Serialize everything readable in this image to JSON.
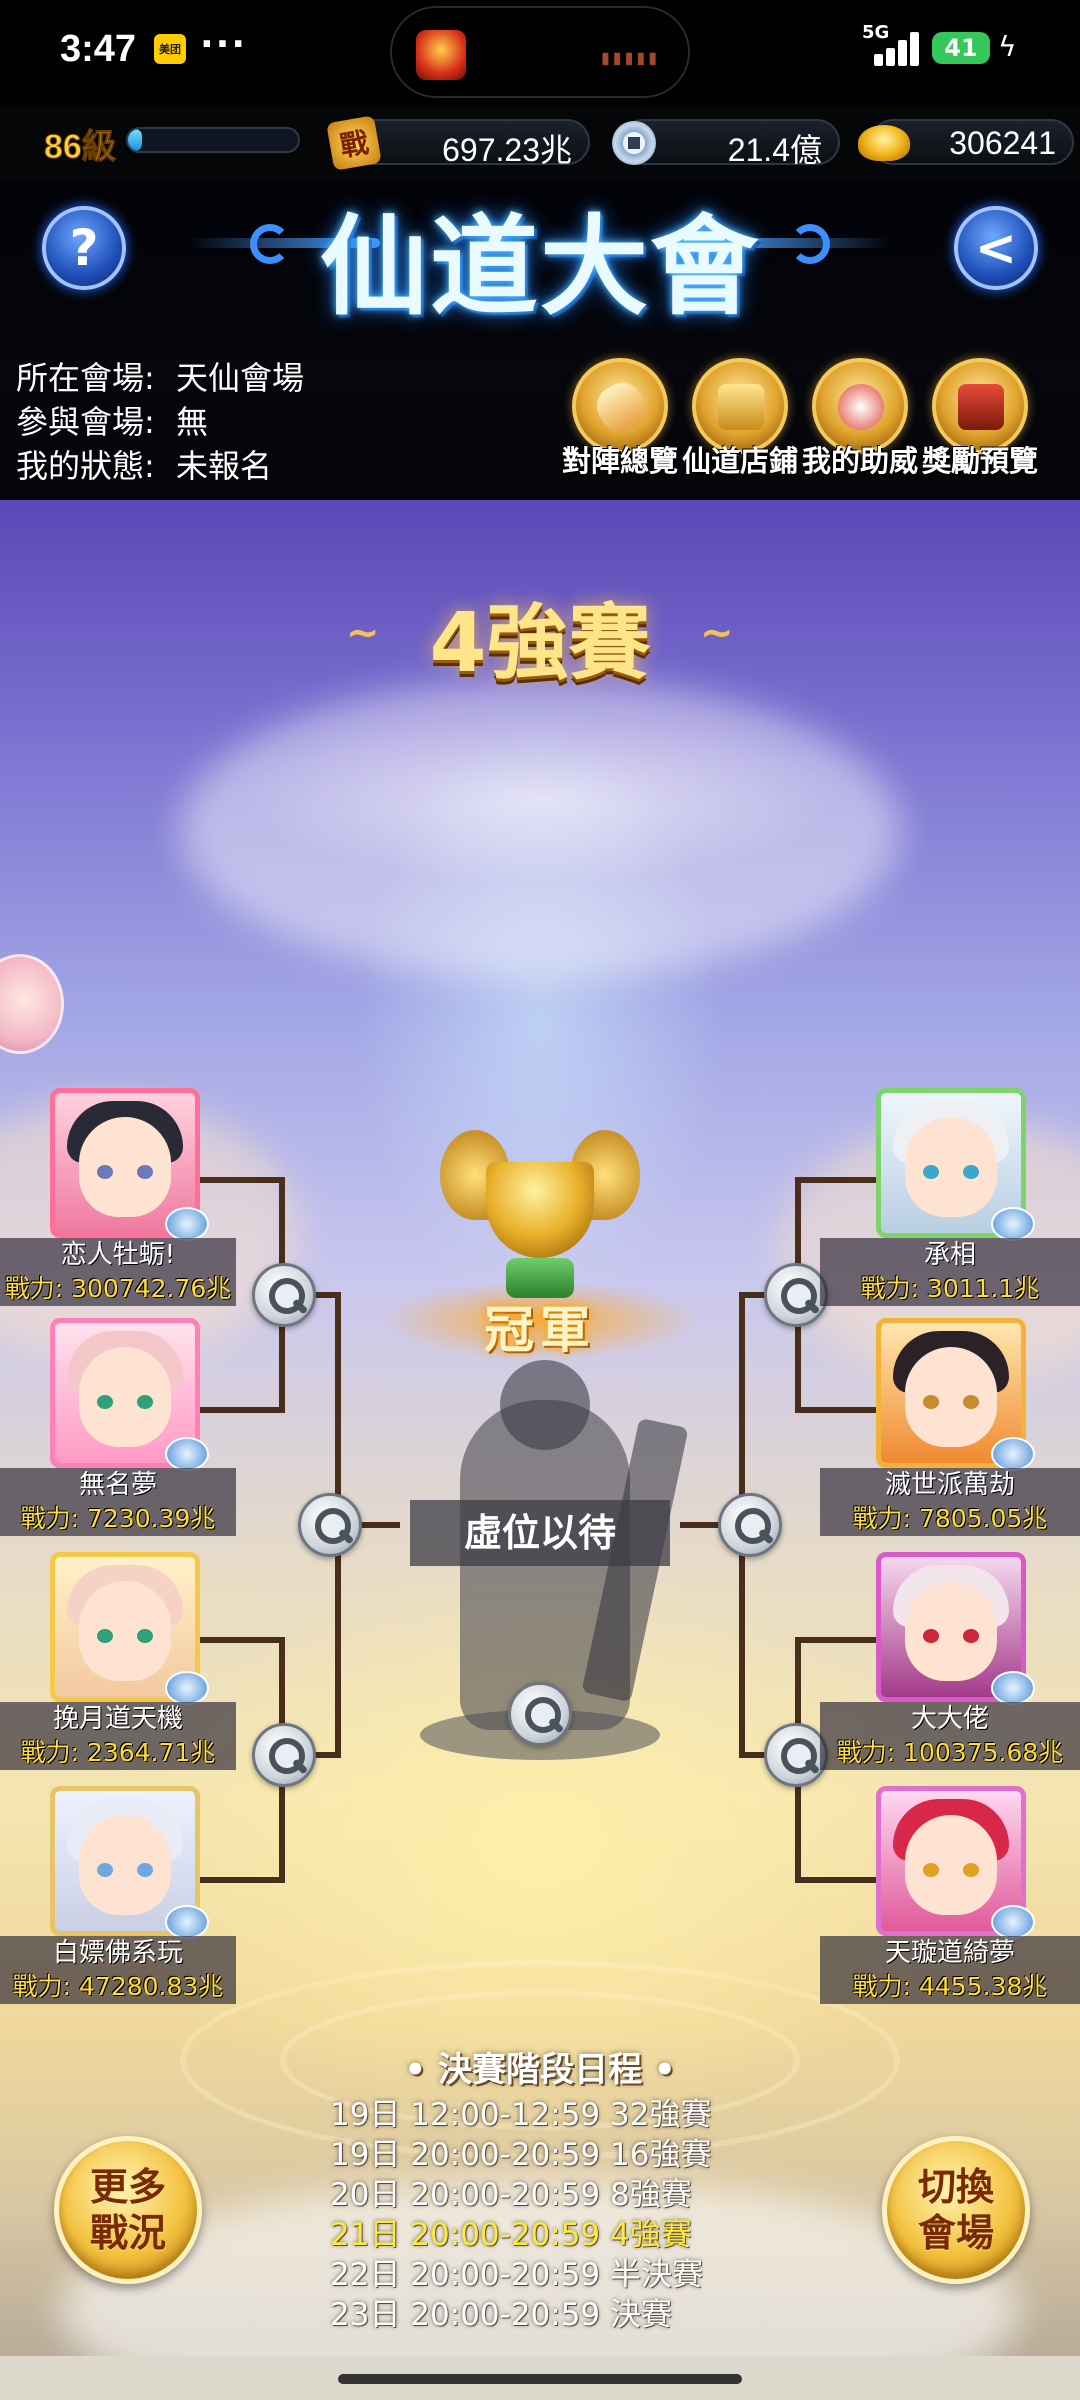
{
  "status_bar": {
    "time": "3:47",
    "app_badge": "美团",
    "dots": "···",
    "network": "5G",
    "battery": "41"
  },
  "resources": {
    "level": "86級",
    "xp_fraction": 0.08,
    "power_icon_text": "戰",
    "power": "697.23兆",
    "silver": "21.4億",
    "gold": "306241"
  },
  "header": {
    "title": "仙道大會",
    "help_symbol": "?",
    "back_symbol": "<"
  },
  "info": [
    {
      "key": "所在會場:",
      "value": "天仙會場"
    },
    {
      "key": "參與會場:",
      "value": "無"
    },
    {
      "key": "我的狀態:",
      "value": "未報名"
    }
  ],
  "shortcuts": [
    {
      "label": "對陣總覽",
      "icon": "scroll-icon"
    },
    {
      "label": "仙道店鋪",
      "icon": "treasure-chest-icon"
    },
    {
      "label": "我的助威",
      "icon": "cheer-icon"
    },
    {
      "label": "獎勵預覽",
      "icon": "reward-chest-icon"
    }
  ],
  "round_title": "4強賽",
  "champion_label": "冠軍",
  "waiting_text": "虛位以待",
  "players_left": [
    {
      "name": "恋人牡蛎!",
      "power": "戰力: 300742.76兆"
    },
    {
      "name": "無名夢",
      "power": "戰力: 7230.39兆"
    },
    {
      "name": "挽月道天機",
      "power": "戰力: 2364.71兆"
    },
    {
      "name": "白嫖佛系玩",
      "power": "戰力: 47280.83兆"
    }
  ],
  "players_right": [
    {
      "name": "承相",
      "power": "戰力: 3011.1兆"
    },
    {
      "name": "滅世派萬劫",
      "power": "戰力: 7805.05兆"
    },
    {
      "name": "大大佬",
      "power": "戰力: 100375.68兆"
    },
    {
      "name": "天璇道綺夢",
      "power": "戰力: 4455.38兆"
    }
  ],
  "schedule": {
    "title": "• 決賽階段日程 •",
    "rows": [
      "19日 12:00-12:59 32強賽",
      "19日 20:00-20:59 16強賽",
      "20日 20:00-20:59 8強賽",
      "21日 20:00-20:59 4強賽",
      "22日 20:00-20:59 半決賽",
      "23日 20:00-20:59 決賽"
    ],
    "active_row": "21日 20:00-20:59 4強賽"
  },
  "buttons": {
    "more_line1": "更多",
    "more_line2": "戰況",
    "switch_line1": "切換",
    "switch_line2": "會場"
  },
  "colors": {
    "accent_gold": "#ffe58a",
    "power_yellow": "#ffdc3c",
    "active_schedule": "#ffe93a",
    "bracket_line": "#4a2e1c"
  }
}
